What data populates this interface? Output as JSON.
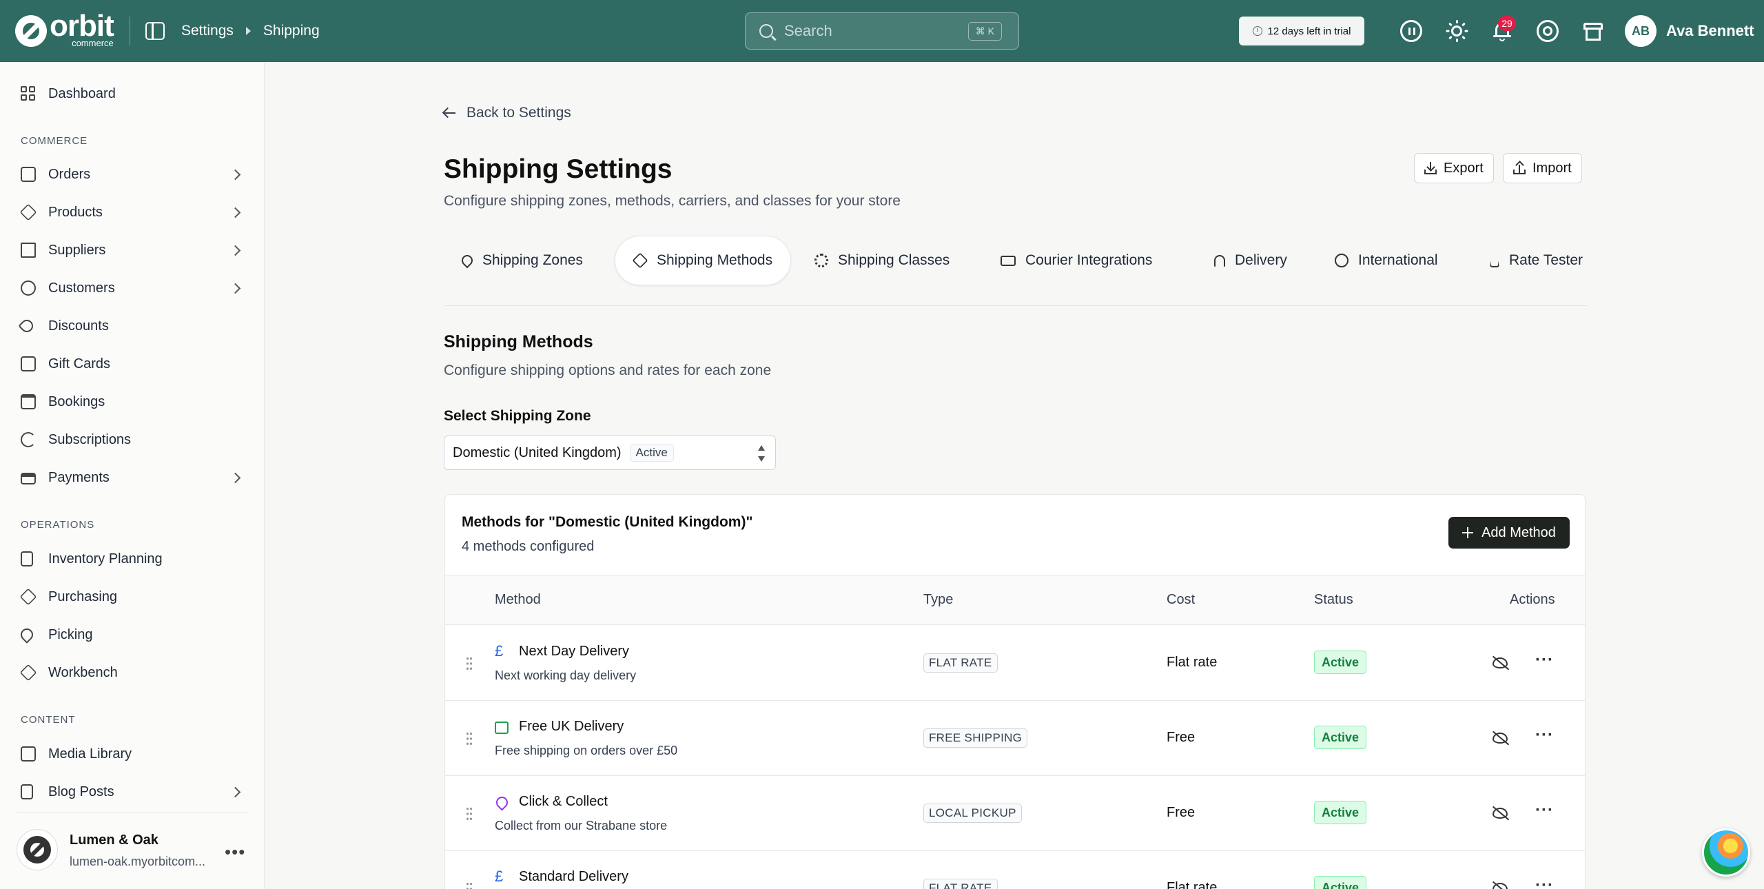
{
  "topbar": {
    "logo_text": "orbit",
    "logo_sub": "commerce",
    "breadcrumb": [
      "Settings",
      "Shipping"
    ],
    "search_placeholder": "Search",
    "search_shortcut": "⌘ K",
    "trial_text": "12 days left in trial",
    "notification_count": "29",
    "user_initials": "AB",
    "user_name": "Ava Bennett"
  },
  "sidebar": {
    "dashboard": "Dashboard",
    "section_commerce": "COMMERCE",
    "commerce_items": [
      "Orders",
      "Products",
      "Suppliers",
      "Customers",
      "Discounts",
      "Gift Cards",
      "Bookings",
      "Subscriptions",
      "Payments"
    ],
    "section_operations": "OPERATIONS",
    "operations_items": [
      "Inventory Planning",
      "Purchasing",
      "Picking",
      "Workbench"
    ],
    "section_content": "CONTENT",
    "content_items": [
      "Media Library",
      "Blog Posts"
    ],
    "workspace_name": "Lumen & Oak",
    "workspace_url": "lumen-oak.myorbitcom..."
  },
  "main": {
    "back_label": "Back to Settings",
    "title": "Shipping Settings",
    "subtitle": "Configure shipping zones, methods, carriers, and classes for your store",
    "export_label": "Export",
    "import_label": "Import",
    "tabs": [
      "Shipping Zones",
      "Shipping Methods",
      "Shipping Classes",
      "Courier Integrations",
      "Delivery",
      "International",
      "Rate Tester"
    ],
    "active_tab": "Shipping Methods",
    "section_title": "Shipping Methods",
    "section_subtitle": "Configure shipping options and rates for each zone",
    "zone_label": "Select Shipping Zone",
    "zone_value": "Domestic (United Kingdom)",
    "zone_badge": "Active",
    "card_title": "Methods for \"Domestic (United Kingdom)\"",
    "card_subtitle": "4 methods configured",
    "add_method_label": "Add Method",
    "columns": [
      "Method",
      "Type",
      "Cost",
      "Status",
      "Actions"
    ],
    "methods": [
      {
        "name": "Next Day Delivery",
        "desc": "Next working day delivery",
        "type": "FLAT RATE",
        "cost": "Flat rate",
        "status": "Active",
        "icon": "pound-icon",
        "icon_glyph": "£",
        "icon_color": "#2563eb"
      },
      {
        "name": "Free UK Delivery",
        "desc": "Free shipping on orders over £50",
        "type": "FREE SHIPPING",
        "cost": "Free",
        "status": "Active",
        "icon": "gift-icon",
        "icon_glyph": "",
        "icon_color": "#16a34a"
      },
      {
        "name": "Click & Collect",
        "desc": "Collect from our Strabane store",
        "type": "LOCAL PICKUP",
        "cost": "Free",
        "status": "Active",
        "icon": "map-pin-icon",
        "icon_glyph": "",
        "icon_color": "#9333ea"
      },
      {
        "name": "Standard Delivery",
        "desc": "",
        "type": "FLAT RATE",
        "cost": "Flat rate",
        "status": "Active",
        "icon": "pound-icon",
        "icon_glyph": "£",
        "icon_color": "#2563eb"
      }
    ]
  }
}
